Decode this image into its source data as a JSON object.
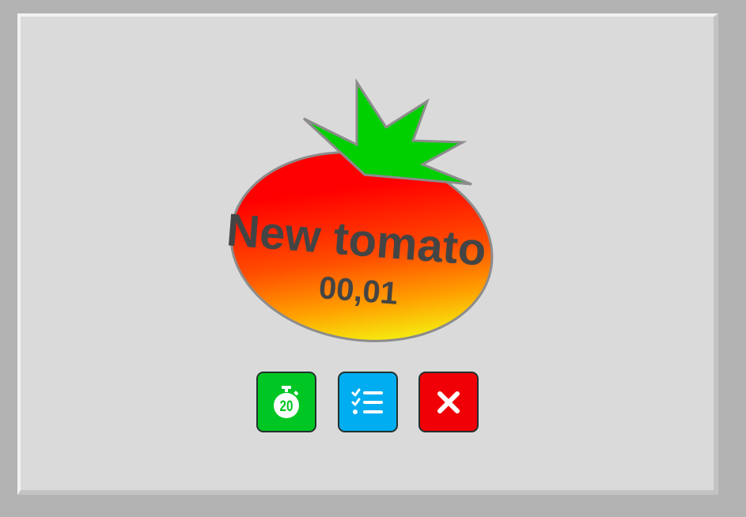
{
  "tomato": {
    "title": "New tomato",
    "timer_value": "00,01"
  },
  "buttons": [
    {
      "id": "timer",
      "icon": "stopwatch-20-icon",
      "badge": "20",
      "color": "#00c623"
    },
    {
      "id": "list",
      "icon": "checklist-icon",
      "color": "#00adf0"
    },
    {
      "id": "close",
      "icon": "close-icon",
      "color": "#f00006"
    }
  ],
  "colors": {
    "background": "#b3b3b3",
    "panel": "#dadada",
    "leaf": "#00d000",
    "outline": "#8c8c8c",
    "text": "#444444"
  }
}
